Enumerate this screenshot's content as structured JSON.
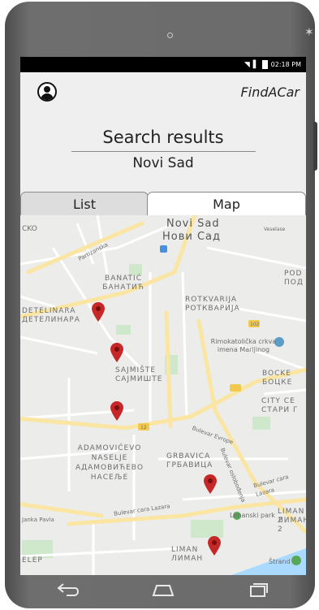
{
  "status_bar": {
    "time": "02:18 PM"
  },
  "header": {
    "app_title": "FindACar",
    "profile_icon": "user-circle-icon"
  },
  "page": {
    "title": "Search results",
    "city": "Novi Sad"
  },
  "tabs": [
    {
      "label": "List",
      "active": false
    },
    {
      "label": "Map",
      "active": true
    }
  ],
  "map": {
    "labels": {
      "novi_sad_lat": "Novi Sad",
      "novi_sad_cyr": "Нови Сад",
      "sko": "CKO",
      "veselase": "Veselase",
      "partizanska": "Partizanska",
      "banatic_lat": "BANATIĆ",
      "banatic_cyr": "БАНАТИЋ",
      "rotkvarija_lat": "ROTKVARIJA",
      "rotkvarija_cyr": "РОТКВАРИЈА",
      "pod_lat": "POD",
      "pod_cyr": "ПОД",
      "detelinara_lat": "DETELINARA",
      "detelinara_cyr": "ДЕТЕЛИНАРА",
      "rimokatolicka_1": "Rimokatolička crkva",
      "rimokatolicka_2": "imena Marijinog",
      "sajmiste_lat": "SAJMIŠTE",
      "sajmiste_cyr": "САЈМИШТЕ",
      "bocke_lat": "BOCKE",
      "bocke_cyr": "БОЦКЕ",
      "city_ce_lat": "CITY CE",
      "city_ce_cyr": "СТАРИ Г",
      "bulevar_oslobodjenja": "Bulevar oslobođenja",
      "bulevar_evrope": "Bulevar Evrope",
      "bulevar_cara_lazara": "Bulevar cara Lazara",
      "bulevar_cara_lazara_2": "Bulevar cara Lazara",
      "adamovicevo_1": "ADAMOVIĆEVO",
      "adamovicevo_2": "NASELJE",
      "adamovicevo_3": "АДАМОВИЋЕВО",
      "adamovicevo_4": "НАСЕЉЕ",
      "grbavica_lat": "GRBAVICA",
      "grbavica_cyr": "ГРБАВИЦА",
      "janka_pavla": "Janka Pavla",
      "liman2_lat": "LIMAN 2",
      "liman2_cyr": "ЛИМАН 2",
      "liman_lat": "LIMAN",
      "liman_cyr": "ЛИМАН",
      "limanski_park": "Limanski park",
      "strand": "Štrand",
      "elep": "ELEP",
      "road_12": "12",
      "road_102": "102"
    },
    "pins": [
      "car-location-pin",
      "car-location-pin",
      "car-location-pin",
      "car-location-pin",
      "car-location-pin"
    ]
  },
  "nav": {
    "back": "back-icon",
    "home": "home-icon",
    "recents": "recents-icon"
  },
  "colors": {
    "pin": "#c62828",
    "road_major": "#fbe5a2",
    "park": "#cfe8cc",
    "water": "#aadaff"
  }
}
